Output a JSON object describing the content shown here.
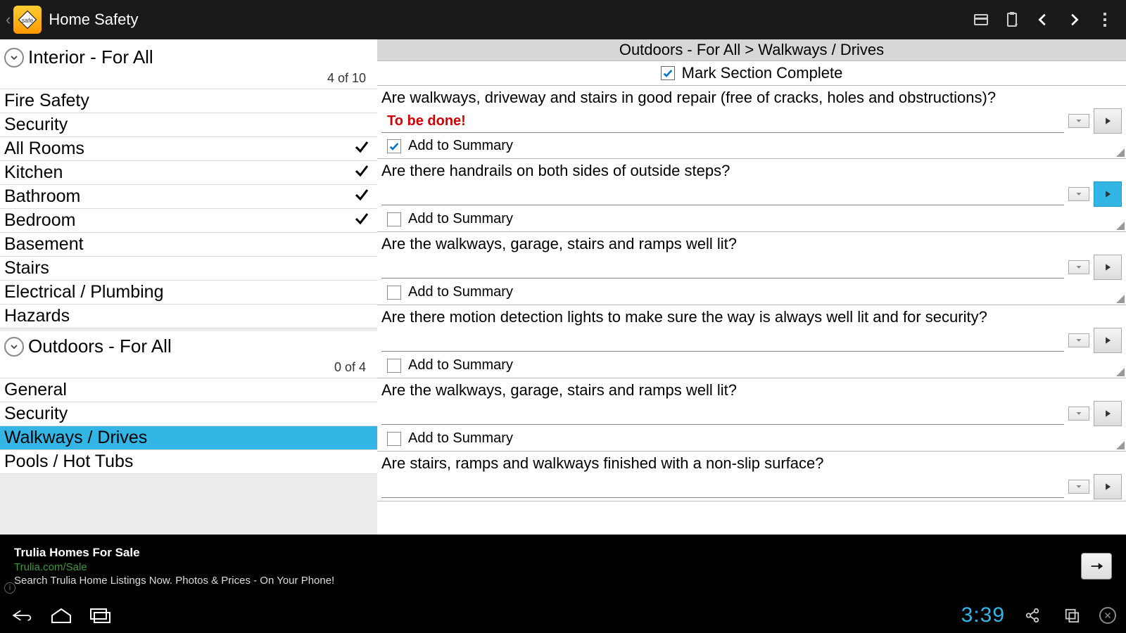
{
  "appbar": {
    "title": "Home Safety"
  },
  "sidebar": {
    "cat1": {
      "title": "Interior - For All",
      "count": "4 of 10",
      "items": [
        {
          "label": "Fire Safety",
          "done": false
        },
        {
          "label": "Security",
          "done": false
        },
        {
          "label": "All Rooms",
          "done": true
        },
        {
          "label": "Kitchen",
          "done": true
        },
        {
          "label": "Bathroom",
          "done": true
        },
        {
          "label": "Bedroom",
          "done": true
        },
        {
          "label": "Basement",
          "done": false
        },
        {
          "label": "Stairs",
          "done": false
        },
        {
          "label": "Electrical / Plumbing",
          "done": false
        },
        {
          "label": "Hazards",
          "done": false
        }
      ]
    },
    "cat2": {
      "title": "Outdoors - For All",
      "count": "0 of 4",
      "items": [
        {
          "label": "General",
          "done": false,
          "selected": false
        },
        {
          "label": "Security",
          "done": false,
          "selected": false
        },
        {
          "label": "Walkways / Drives",
          "done": false,
          "selected": true
        },
        {
          "label": "Pools / Hot Tubs",
          "done": false,
          "selected": false
        }
      ]
    }
  },
  "content": {
    "breadcrumb": "Outdoors - For All > Walkways / Drives",
    "mark_complete_label": "Mark Section Complete",
    "mark_complete_checked": true,
    "add_to_summary_label": "Add to Summary",
    "questions": [
      {
        "text": "Are walkways, driveway and stairs in good repair (free of cracks, holes and obstructions)?",
        "answer": "To be done!",
        "add": true,
        "active": false
      },
      {
        "text": "Are there handrails on both sides of outside steps?",
        "answer": "",
        "add": false,
        "active": true
      },
      {
        "text": "Are the walkways, garage, stairs and ramps well lit?",
        "answer": "",
        "add": false,
        "active": false
      },
      {
        "text": "Are there motion detection lights to make sure the way is always well lit and for security?",
        "answer": "",
        "add": false,
        "active": false
      },
      {
        "text": "Are the walkways, garage, stairs and ramps well lit?",
        "answer": "",
        "add": false,
        "active": false
      },
      {
        "text": "Are stairs, ramps and walkways finished with a non-slip surface?",
        "answer": "",
        "add": false,
        "active": false
      }
    ]
  },
  "ad": {
    "title": "Trulia Homes For Sale",
    "url": "Trulia.com/Sale",
    "desc": "Search Trulia Home Listings Now. Photos & Prices - On Your Phone!"
  },
  "sysbar": {
    "time": "3:39"
  }
}
